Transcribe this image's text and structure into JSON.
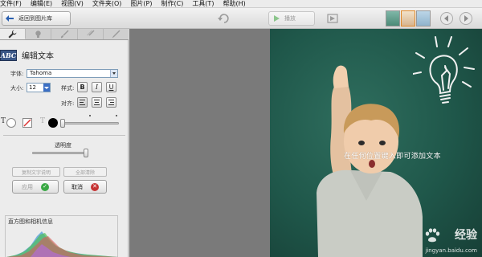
{
  "menu": [
    "文件(F)",
    "编辑(E)",
    "视图(V)",
    "文件夹(O)",
    "图片(P)",
    "制作(C)",
    "工具(T)",
    "帮助(H)"
  ],
  "toolbar": {
    "back_label": "返回到图片库",
    "play_label": "播放"
  },
  "panel": {
    "heading": "编辑文本",
    "font_label": "字体:",
    "font_value": "Tahoma",
    "size_label": "大小:",
    "size_value": "12",
    "style_label": "样式:",
    "bold": "B",
    "italic": "I",
    "underline": "U",
    "align_label": "对齐:",
    "opacity_label": "透明度",
    "copy_text_btn": "复制文字说明",
    "clear_all_btn": "全部清除",
    "apply_btn": "应用",
    "cancel_btn": "取消",
    "histogram_title": "直方图和相机信息"
  },
  "canvas": {
    "overlay_text": "在任何位置键入即可添加文本",
    "watermark": "经验",
    "watermark_url": "jingyan.baidu.com"
  },
  "colors": {
    "accent_green": "#39a844",
    "cancel_red": "#c63333",
    "chalkboard": "#245e50"
  }
}
